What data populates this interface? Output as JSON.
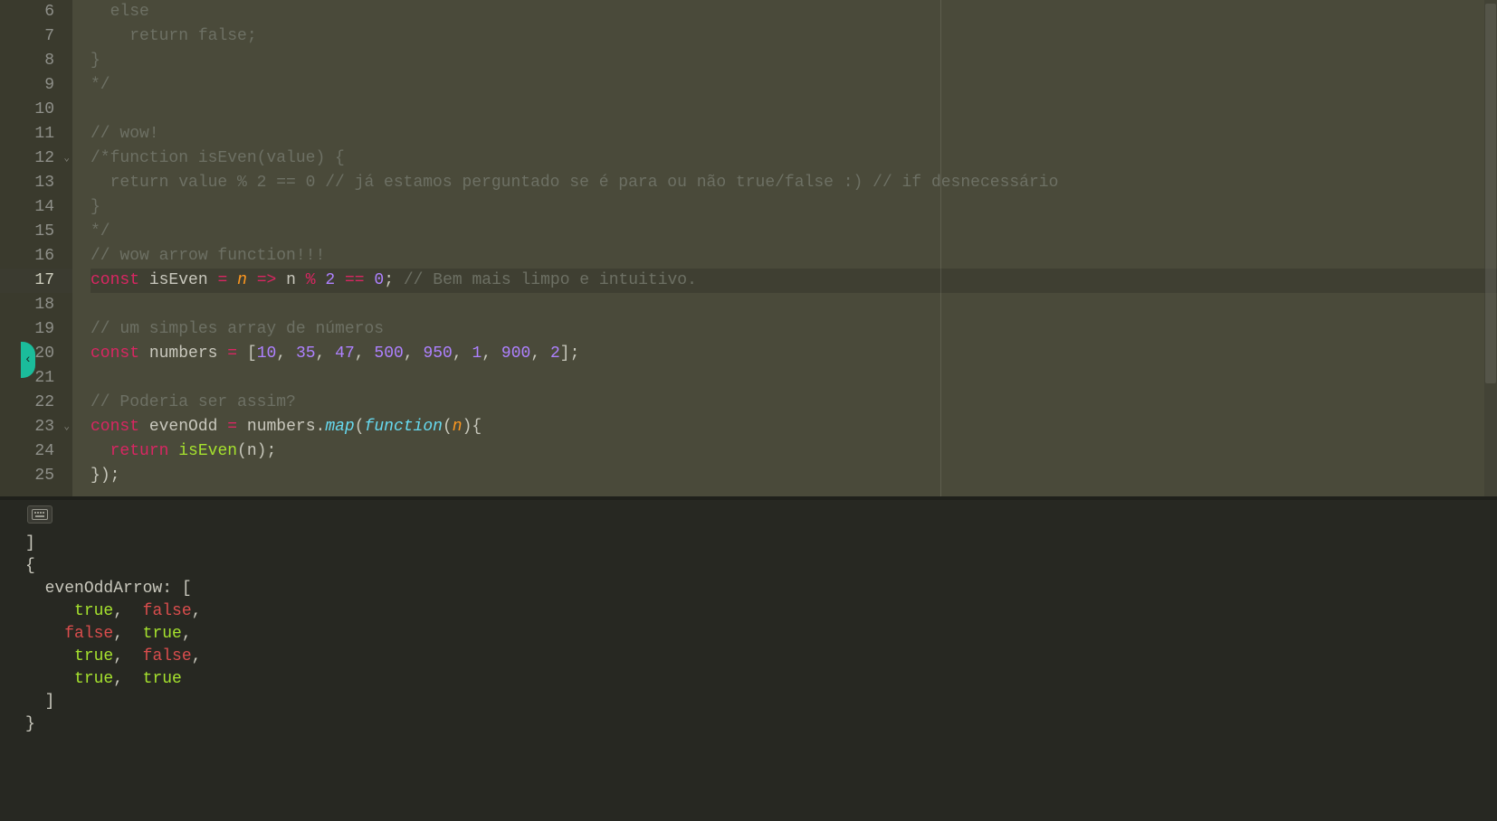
{
  "gutter": {
    "start": 6,
    "end": 25,
    "current": 17,
    "fold_lines": [
      12,
      23
    ]
  },
  "code": {
    "l6": {
      "indent": "  ",
      "kw": "else"
    },
    "l7": {
      "indent": "    ",
      "kw": "return",
      "sp": " ",
      "val": "false",
      "semi": ";"
    },
    "l8": {
      "brace": "}"
    },
    "l9": {
      "comment": "*/"
    },
    "l10": {
      "blank": ""
    },
    "l11": {
      "comment": "// wow!"
    },
    "l12": {
      "comment": "/*function isEven(value) {"
    },
    "l13": {
      "comment": "  return value % 2 == 0 // já estamos perguntado se é para ou não true/false :) // if desnecessário"
    },
    "l14": {
      "comment": "}"
    },
    "l15": {
      "comment": "*/"
    },
    "l16": {
      "comment": "// wow arrow function!!!"
    },
    "l17": {
      "storage": "const",
      "sp1": " ",
      "name": "isEven",
      "sp2": " ",
      "eq": "=",
      "sp3": " ",
      "param": "n",
      "sp4": " ",
      "arrow": "=>",
      "sp5": " ",
      "id": "n",
      "sp6": " ",
      "mod": "%",
      "sp7": " ",
      "two": "2",
      "sp8": " ",
      "eqeq": "==",
      "sp9": " ",
      "zero": "0",
      "semi": ";",
      "sp10": " ",
      "comment": "// Bem mais limpo e intuitivo."
    },
    "l18": {
      "blank": ""
    },
    "l19": {
      "comment": "// um simples array de números"
    },
    "l20": {
      "storage": "const",
      "sp1": " ",
      "name": "numbers",
      "sp2": " ",
      "eq": "=",
      "sp3": " ",
      "lb": "[",
      "nums": [
        "10",
        "35",
        "47",
        "500",
        "950",
        "1",
        "900",
        "2"
      ],
      "rb": "]",
      "semi": ";"
    },
    "l21": {
      "blank": ""
    },
    "l22": {
      "comment": "// Poderia ser assim?"
    },
    "l23": {
      "storage": "const",
      "sp1": " ",
      "name": "evenOdd",
      "sp2": " ",
      "eq": "=",
      "sp3": " ",
      "obj": "numbers",
      "dot": ".",
      "method": "map",
      "lp": "(",
      "func": "function",
      "lp2": "(",
      "param": "n",
      "rp2": ")",
      "lb": "{"
    },
    "l24": {
      "indent": "  ",
      "kw": "return",
      "sp": " ",
      "fn": "isEven",
      "lp": "(",
      "arg": "n",
      "rp": ")",
      "semi": ";"
    },
    "l25": {
      "rb": "}",
      "rp": ")",
      "semi": ";"
    }
  },
  "output": {
    "l1": "]",
    "l2": "{",
    "key": "evenOddArrow",
    "colon": ": [",
    "rows": [
      [
        "true",
        "false"
      ],
      [
        "false",
        "true"
      ],
      [
        "true",
        "false"
      ],
      [
        "true",
        "true"
      ]
    ],
    "close_arr": "]",
    "close_obj": "}"
  },
  "colors": {
    "accent": "#1bbc9b",
    "comment": "#6d7064",
    "keyword": "#d92662",
    "number": "#ae81ff",
    "entity": "#a6e22e",
    "function": "#66d9ef"
  }
}
